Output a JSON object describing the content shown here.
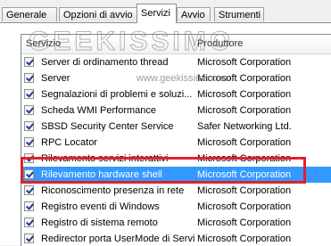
{
  "tabs": [
    {
      "label": "Generale"
    },
    {
      "label": "Opzioni di avvio"
    },
    {
      "label": "Servizi"
    },
    {
      "label": "Avvio"
    },
    {
      "label": "Strumenti"
    }
  ],
  "active_tab": "Servizi",
  "columns": {
    "service": "Servizio",
    "manufacturer": "Produttore"
  },
  "rows": [
    {
      "name": "Server di ordinamento thread",
      "manufacturer": "Microsoft Corporation",
      "checked": true
    },
    {
      "name": "Server",
      "manufacturer": "Microsoft Corporation",
      "checked": true
    },
    {
      "name": "Segnalazioni di problemi e soluzi...",
      "manufacturer": "Microsoft Corporation",
      "checked": true
    },
    {
      "name": "Scheda WMI Performance",
      "manufacturer": "Microsoft Corporation",
      "checked": true
    },
    {
      "name": "SBSD Security Center Service",
      "manufacturer": "Safer Networking Ltd.",
      "checked": true
    },
    {
      "name": "RPC Locator",
      "manufacturer": "Microsoft Corporation",
      "checked": true
    },
    {
      "name": "Rilevamento servizi interattivi",
      "manufacturer": "Microsoft Corporation",
      "checked": true
    },
    {
      "name": "Rilevamento hardware shell",
      "manufacturer": "Microsoft Corporation",
      "checked": true,
      "selected": true
    },
    {
      "name": "Riconoscimento presenza in rete",
      "manufacturer": "Microsoft Corporation",
      "checked": true
    },
    {
      "name": "Registro eventi di Windows",
      "manufacturer": "Microsoft Corporation",
      "checked": true
    },
    {
      "name": "Registro di sistema remoto",
      "manufacturer": "Microsoft Corporation",
      "checked": true
    },
    {
      "name": "Redirector porta UserMode di Servizi ...",
      "manufacturer": "Microsoft Corporation",
      "checked": true
    }
  ],
  "watermark": {
    "logo": "GEEKISSIMO",
    "url": "www.geekissimo.com"
  },
  "colors": {
    "selection": "#3399ff",
    "highlight_box": "#e2202c"
  }
}
